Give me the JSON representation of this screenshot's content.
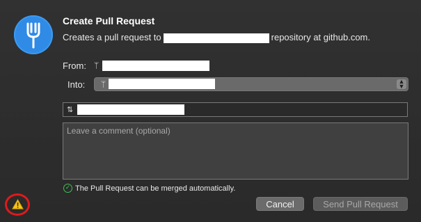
{
  "dialog": {
    "title": "Create Pull Request",
    "subtitle_prefix": "Creates a pull request to",
    "subtitle_suffix": "repository at github.com."
  },
  "form": {
    "from_label": "From:",
    "into_label": "Into:",
    "comment_placeholder": "Leave a comment (optional)"
  },
  "status": {
    "merge_message": "The Pull Request can be merged automatically."
  },
  "buttons": {
    "cancel": "Cancel",
    "send": "Send Pull Request"
  },
  "icons": {
    "app": "fork-icon",
    "branch": "branch-icon",
    "pull_request": "pull-request-icon",
    "status": "check-circle-icon",
    "warning": "warning-icon"
  },
  "colors": {
    "app_icon": "#2f8be6",
    "success": "#3fbf55",
    "warning": "#f5c518",
    "highlight_circle": "#e01a1a"
  }
}
